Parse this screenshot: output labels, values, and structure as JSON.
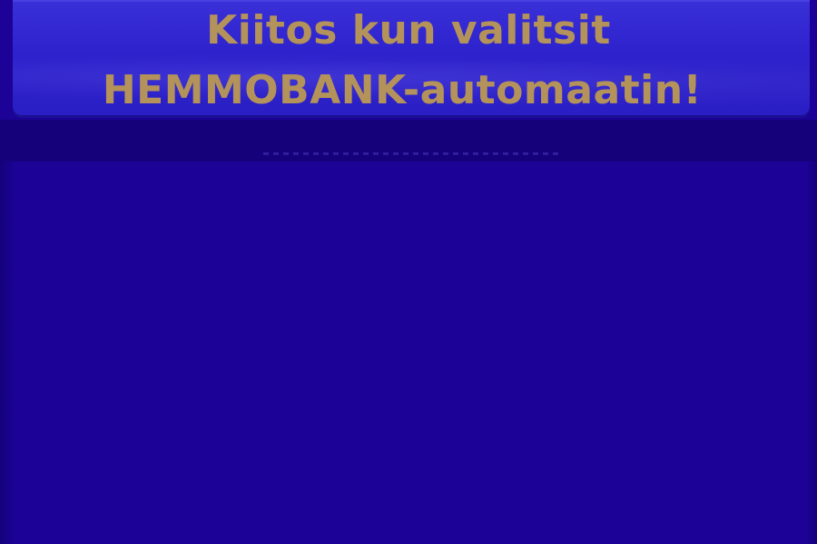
{
  "screen": {
    "title_line1": "Kiitos kun valitsit",
    "title_line2": "HEMMOBANK-automaatin!"
  },
  "colors": {
    "background": "#1c0296",
    "header_panel": "#2d22cc",
    "title_text": "#b4935a"
  }
}
